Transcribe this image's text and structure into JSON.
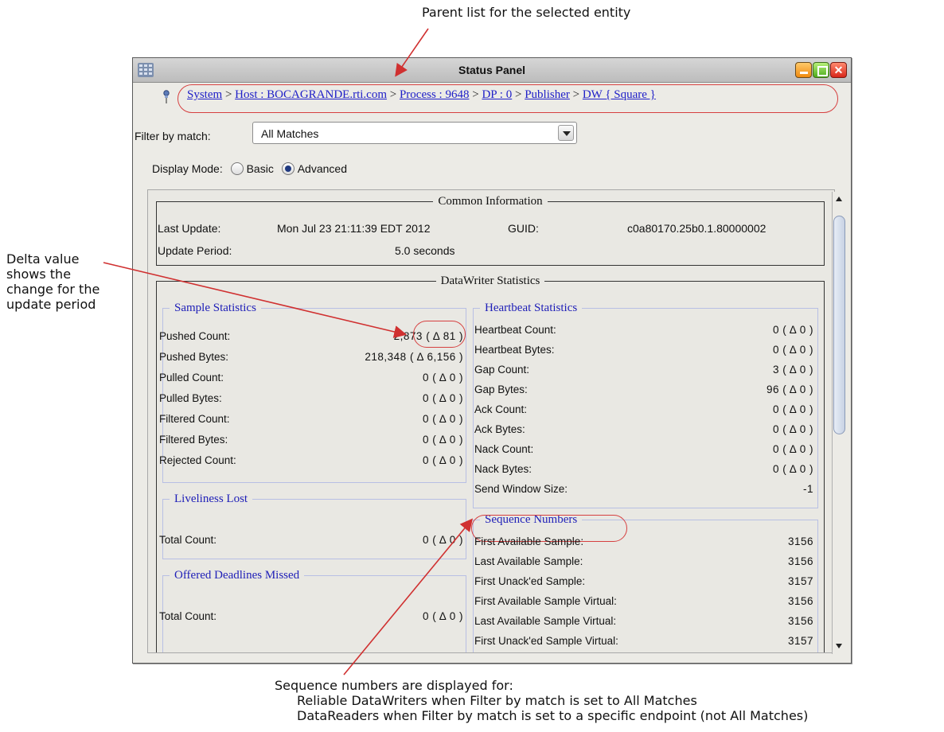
{
  "annotations": {
    "top": "Parent list for the selected entity",
    "left": "Delta value shows the change for the update period",
    "bottom_lines": [
      "Sequence numbers are displayed for:",
      "Reliable DataWriters when Filter by match is set to All Matches",
      "DataReaders when Filter by match is set to a specific endpoint (not All Matches)"
    ]
  },
  "window": {
    "title": "Status Panel",
    "breadcrumb": [
      {
        "label": "System"
      },
      {
        "label": "Host : BOCAGRANDE.rti.com"
      },
      {
        "label": "Process : 9648"
      },
      {
        "label": "DP : 0"
      },
      {
        "label": "Publisher"
      },
      {
        "label": "DW { Square }"
      }
    ],
    "breadcrumb_separator": ">",
    "filter_label": "Filter by match:",
    "filter_value": "All Matches",
    "display_mode_label": "Display Mode:",
    "display_modes": [
      {
        "label": "Basic",
        "selected": false
      },
      {
        "label": "Advanced",
        "selected": true
      }
    ]
  },
  "common_information": {
    "title": "Common Information",
    "last_update_label": "Last Update:",
    "last_update_value": "Mon Jul 23 21:11:39 EDT 2012",
    "guid_label": "GUID:",
    "guid_value": "c0a80170.25b0.1.80000002",
    "update_period_label": "Update Period:",
    "update_period_value": "5.0 seconds"
  },
  "datawriter_statistics": {
    "title": "DataWriter Statistics",
    "sample_statistics": {
      "title": "Sample Statistics",
      "rows": [
        {
          "label": "Pushed Count:",
          "value": "2,873",
          "delta": "( Δ 81 )"
        },
        {
          "label": "Pushed Bytes:",
          "value": "218,348",
          "delta": "( Δ 6,156 )"
        },
        {
          "label": "Pulled Count:",
          "value": "0",
          "delta": "( Δ 0 )"
        },
        {
          "label": "Pulled Bytes:",
          "value": "0",
          "delta": "( Δ 0 )"
        },
        {
          "label": "Filtered Count:",
          "value": "0",
          "delta": "( Δ 0 )"
        },
        {
          "label": "Filtered Bytes:",
          "value": "0",
          "delta": "( Δ 0 )"
        },
        {
          "label": "Rejected Count:",
          "value": "0",
          "delta": "( Δ 0 )"
        }
      ]
    },
    "liveliness_lost": {
      "title": "Liveliness Lost",
      "rows": [
        {
          "label": "Total Count:",
          "value": "0",
          "delta": "( Δ 0 )"
        }
      ]
    },
    "offered_deadlines_missed": {
      "title": "Offered Deadlines Missed",
      "rows": [
        {
          "label": "Total Count:",
          "value": "0",
          "delta": "( Δ 0 )"
        }
      ]
    },
    "heartbeat_statistics": {
      "title": "Heartbeat Statistics",
      "rows": [
        {
          "label": "Heartbeat Count:",
          "value": "0 ( Δ 0 )"
        },
        {
          "label": "Heartbeat Bytes:",
          "value": "0 ( Δ 0 )"
        },
        {
          "label": "Gap Count:",
          "value": "3 ( Δ 0 )"
        },
        {
          "label": "Gap Bytes:",
          "value": "96 ( Δ 0 )"
        },
        {
          "label": "Ack Count:",
          "value": "0 ( Δ 0 )"
        },
        {
          "label": "Ack Bytes:",
          "value": "0 ( Δ 0 )"
        },
        {
          "label": "Nack Count:",
          "value": "0 ( Δ 0 )"
        },
        {
          "label": "Nack Bytes:",
          "value": "0 ( Δ 0 )"
        },
        {
          "label": "Send Window Size:",
          "value": "-1"
        }
      ]
    },
    "sequence_numbers": {
      "title": "Sequence Numbers",
      "rows": [
        {
          "label": "First Available Sample:",
          "value": "3156"
        },
        {
          "label": "Last Available Sample:",
          "value": "3156"
        },
        {
          "label": "First Unack'ed Sample:",
          "value": "3157"
        },
        {
          "label": "First Available Sample Virtual:",
          "value": "3156"
        },
        {
          "label": "Last Available Sample Virtual:",
          "value": "3156"
        },
        {
          "label": "First Unack'ed Sample Virtual:",
          "value": "3157"
        }
      ]
    }
  }
}
